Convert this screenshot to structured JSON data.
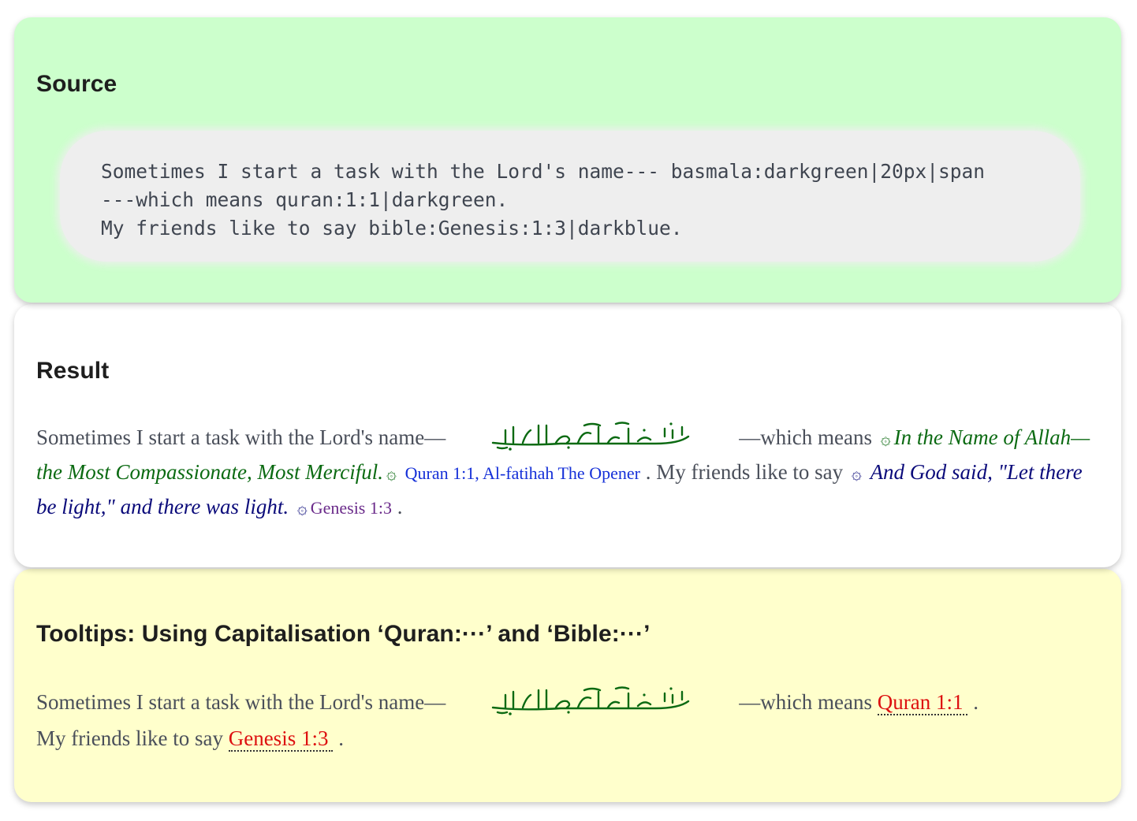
{
  "source": {
    "heading": "Source",
    "code_lines": [
      "Sometimes I start a task with the Lord's name--- basmala:darkgreen|20px|span",
      "---which means quran:1:1|darkgreen.",
      "My friends like to say bible:Genesis:1:3|darkblue."
    ]
  },
  "result": {
    "heading": "Result",
    "intro": "Sometimes I start a task with the Lord's name—",
    "after_basmala": "—which means",
    "quran_quote": "In the Name of Allah—the Most Compassionate, Most Merciful.",
    "quran_ref": "Quran 1:1, Al-fatihah The Opener",
    "friends": ". My friends like to say",
    "bible_quote": "And God said, \"Let there be light,\" and there was light.",
    "bible_ref": "Genesis 1:3",
    "end": "."
  },
  "tooltips": {
    "heading": "Tooltips: Using Capitalisation ‘Quran:···’ and ‘Bible:···’",
    "intro": "Sometimes I start a task with the Lord's name—",
    "after_basmala": "—which means",
    "quran_link": "Quran 1:1",
    "sep": ".",
    "friends": "My friends like to say",
    "bible_link": "Genesis 1:3",
    "end": "."
  },
  "ornaments": {
    "open": "۞",
    "close": "۞"
  },
  "colors": {
    "source_bg": "#ccffcc",
    "result_bg": "#ffffff",
    "tooltips_bg": "#ffffcc",
    "darkgreen": "#0b6a12",
    "darkblue": "#0a0a7a",
    "link_red": "#dd1010",
    "ref_blue": "#1530d8",
    "ref_purple": "#6a2a8a"
  },
  "icons": {
    "basmala": "basmala-calligraphy",
    "ornament": "quran-verse-ornament"
  }
}
